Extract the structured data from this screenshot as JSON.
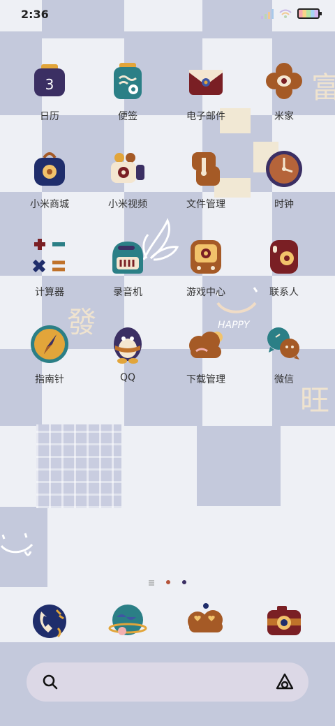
{
  "status": {
    "time": "2:36"
  },
  "apps": [
    {
      "label": "日历",
      "icon": "calendar-icon",
      "badge": "3"
    },
    {
      "label": "便签",
      "icon": "notes-icon"
    },
    {
      "label": "电子邮件",
      "icon": "mail-icon"
    },
    {
      "label": "米家",
      "icon": "mijia-flower-icon"
    },
    {
      "label": "小米商城",
      "icon": "shop-bag-icon"
    },
    {
      "label": "小米视频",
      "icon": "video-camera-icon"
    },
    {
      "label": "文件管理",
      "icon": "file-manager-icon"
    },
    {
      "label": "时钟",
      "icon": "clock-icon"
    },
    {
      "label": "计算器",
      "icon": "calculator-icon"
    },
    {
      "label": "录音机",
      "icon": "recorder-icon"
    },
    {
      "label": "游戏中心",
      "icon": "game-center-icon"
    },
    {
      "label": "联系人",
      "icon": "contacts-icon"
    },
    {
      "label": "指南针",
      "icon": "compass-icon"
    },
    {
      "label": "QQ",
      "icon": "qq-penguin-icon"
    },
    {
      "label": "下载管理",
      "icon": "download-cloud-icon"
    },
    {
      "label": "微信",
      "icon": "wechat-icon"
    }
  ],
  "decor": {
    "chars": [
      "富",
      "發",
      "旺"
    ],
    "sticker_text": "HAPPY"
  },
  "dock": [
    {
      "icon": "phone-icon"
    },
    {
      "icon": "browser-planet-icon"
    },
    {
      "icon": "messages-cloud-heart-icon"
    },
    {
      "icon": "camera-icon"
    }
  ],
  "pager": {
    "pages": 2,
    "current": 1
  },
  "colors": {
    "tile": "#c4c9dc",
    "background": "#eef0f5",
    "cream": "#f1e8d4",
    "navy": "#1f2d6b",
    "maroon": "#7a1f24",
    "teal": "#2b7f86",
    "orange": "#c0722a"
  }
}
